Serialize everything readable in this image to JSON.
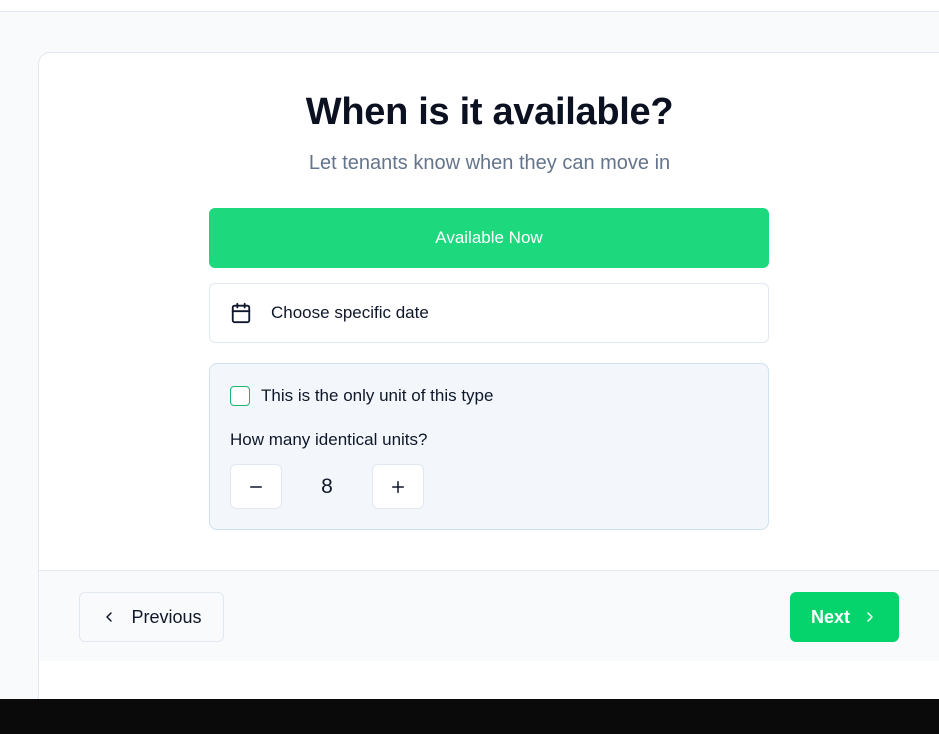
{
  "header": {
    "title": "When is it available?",
    "subtitle": "Let tenants know when they can move in"
  },
  "availability": {
    "available_now_label": "Available Now",
    "choose_date_label": "Choose specific date",
    "calendar_icon": "calendar-icon",
    "selected": "Available Now"
  },
  "units": {
    "only_unit_label": "This is the only unit of this type",
    "only_unit_checked": false,
    "count_question": "How many identical units?",
    "count_value": "8",
    "decrement_icon": "minus-icon",
    "increment_icon": "plus-icon"
  },
  "footer": {
    "previous_label": "Previous",
    "next_label": "Next"
  },
  "colors": {
    "primary_green": "#1dd87c",
    "next_green": "#05d46d",
    "subtitle_gray": "#64748b",
    "units_bg": "#f3f7fc"
  }
}
